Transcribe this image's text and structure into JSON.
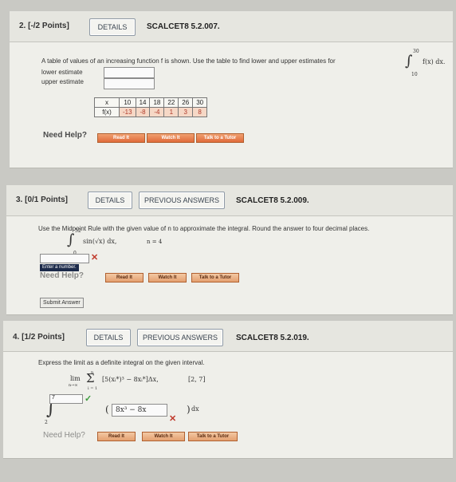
{
  "q2": {
    "title": "2. [-/2 Points]",
    "details": "DETAILS",
    "code": "SCALCET8 5.2.007.",
    "prompt": "A table of values of an increasing function f is shown. Use the table to find lower and upper estimates for",
    "integral_upper": "30",
    "integral_lower": "10",
    "integrand": "f(x) dx.",
    "lower_label": "lower estimate",
    "upper_label": "upper estimate",
    "table": {
      "x_label": "x",
      "fx_label": "f(x)",
      "x": [
        "10",
        "14",
        "18",
        "22",
        "26",
        "30"
      ],
      "fx": [
        "-13",
        "-8",
        "-4",
        "1",
        "3",
        "8"
      ]
    },
    "need_help": "Need Help?",
    "read_it": "Read It",
    "watch_it": "Watch It",
    "talk": "Talk to a Tutor"
  },
  "q3": {
    "title": "3. [0/1 Points]",
    "details": "DETAILS",
    "previous": "PREVIOUS ANSWERS",
    "code": "SCALCET8 5.2.009.",
    "prompt": "Use the Midpoint Rule with the given value of n to approximate the integral. Round the answer to four decimal places.",
    "int_upper": "32",
    "int_lower": "0",
    "integrand": "sin(√x) dx,",
    "n": "n = 4",
    "tooltip": "Enter a number.",
    "need_help": "Need Help?",
    "read_it": "Read It",
    "watch_it": "Watch It",
    "talk": "Talk to a Tutor",
    "submit": "Submit Answer"
  },
  "q4": {
    "title": "4. [1/2 Points]",
    "details": "DETAILS",
    "previous": "PREVIOUS ANSWERS",
    "code": "SCALCET8 5.2.019.",
    "prompt": "Express the limit as a definite integral on the given interval.",
    "lim": "lim",
    "lim_sub": "n→∞",
    "sum_top": "n",
    "sum_bottom": "i = 1",
    "expr": "[5(xᵢ*)³ − 8xᵢ*]Δx,",
    "interval": "[2, 7]",
    "int_upper_answer": "7",
    "int_lower": "2",
    "integrand_answer": "8x³ − 8x",
    "dx": "dx",
    "need_help": "Need Help?",
    "read_it": "Read It",
    "watch_it": "Watch It",
    "talk": "Talk to a Tutor"
  }
}
